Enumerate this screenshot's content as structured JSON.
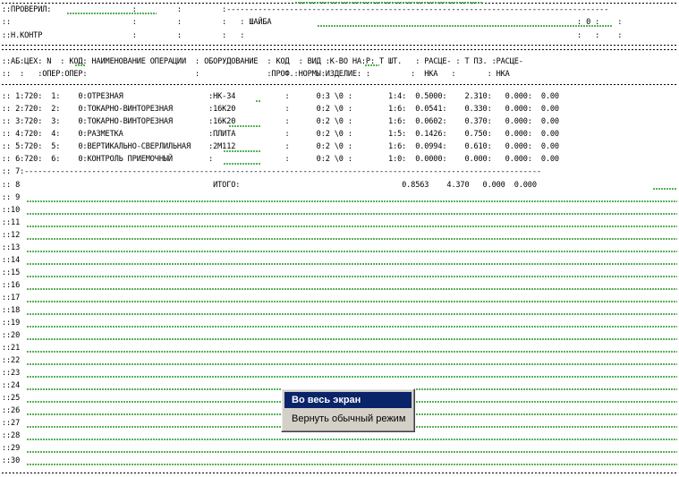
{
  "document": {
    "header_lines": [
      "::ПРОВЕРИЛ:                  :         :         :-------------------------------------------------------------------------------------",
      "::                           :         :         :   : ШАЙБА                                                                    : 0 :    :",
      "::Н.КОНТР                    :         :         :   :                                                                          :   :    :"
    ],
    "column_header_lines": [
      "::АБ:ЦЕХ: N  : КОД: НАИМЕНОВАНИЕ ОПЕРАЦИИ  : ОБОРУДОВАНИЕ  : КОД  : ВИД :К-ВО НА:Р: Т ШТ.   : РАСЦЕ- : Т ПЗ. :РАСЦЕ-",
      "::  :   :ОПЕР:ОПЕР:                        :               :ПРОФ.:НОРМЫ:ИЗДЕЛИЕ: :         :  НКА   :       : НКА"
    ],
    "rows": [
      ":: 1:720:  1:    0:ОТРЕЗНАЯ                   :НК-34           :      0:3 \\0 :        1:4:  0.5000:    2.310:   0.000:  0.00",
      ":: 2:720:  2:    0:ТОКАРНО-ВИНТОРЕЗНАЯ        :16К20           :      0:2 \\0 :        1:6:  0.0541:    0.330:   0.000:  0.00",
      ":: 3:720:  3:    0:ТОКАРНО-ВИНТОРЕЗНАЯ        :16К20           :      0:2 \\0 :        1:6:  0.0602:    0.370:   0.000:  0.00",
      ":: 4:720:  4:    0:РАЗМЕТКА                   :ПЛИТА           :      0:2 \\0 :        1:5:  0.1426:    0.750:   0.000:  0.00",
      ":: 5:720:  5:    0:ВЕРТИКАЛЬНО-СВЕРЛИЛЬНАЯ    :2М112           :      0:2 \\0 :        1:6:  0.0994:    0.610:   0.000:  0.00",
      ":: 6:720:  6:    0:КОНТРОЛЬ ПРИЕМОЧНЫЙ        :                :      0:2 \\0 :        1:0:  0.0000:    0.000:   0.000:  0.00",
      ":: 7:-------------------------------------------------------------------------------------------------------------------"
    ],
    "total_line": ":: 8                                           ИТОГО:                                    0.8563    4.370   0.000  0.000",
    "empty_lines": [
      ":: 9",
      "::10",
      "::11",
      "::12",
      "::13",
      "::14",
      "::15",
      "::16",
      "::17",
      "::18",
      "::19",
      "::20",
      "::21",
      "::22",
      "::23",
      "::24",
      "::25",
      "::26",
      "::27",
      "::28",
      "::29",
      "::30"
    ]
  },
  "context_menu": {
    "full_screen": "Во весь экран",
    "restore_normal": "Вернуть обычный режим"
  },
  "colors": {
    "spell_check_wave": "#2e9d2e",
    "menu_background": "#d4d0c8",
    "menu_highlight": "#0a246a"
  }
}
